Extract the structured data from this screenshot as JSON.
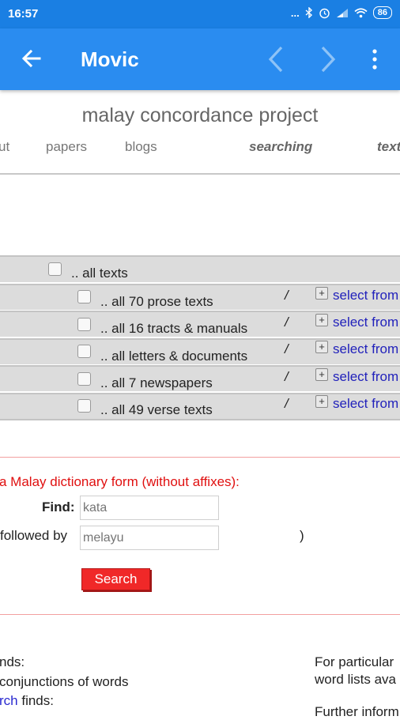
{
  "status_bar": {
    "time": "16:57",
    "indicators": "...",
    "battery": "86"
  },
  "app_bar": {
    "title": "Movic"
  },
  "page": {
    "site_title": "malay concordance project",
    "nav": [
      "ut",
      "papers",
      "blogs",
      "searching",
      "text"
    ]
  },
  "texts_table": {
    "all_label": ".. all texts",
    "slash": "/",
    "select_label": "select from",
    "rows": [
      {
        "label": ".. all 70 prose texts"
      },
      {
        "label": ".. all 16 tracts & manuals"
      },
      {
        "label": ".. all letters & documents"
      },
      {
        "label": ".. all 7 newspapers"
      },
      {
        "label": ".. all 49 verse texts"
      }
    ]
  },
  "search_form": {
    "instruction": "a Malay dictionary form (without affixes):",
    "find_label": "Find:",
    "find_placeholder": "kata",
    "followed_label": "followed by",
    "followed_placeholder": "melayu",
    "paren": ")",
    "search_button": "Search"
  },
  "footer": {
    "line1": "nds:",
    "line2": "conjunctions of words",
    "line3_link": "rch",
    "line3_text": " finds:",
    "right1": "For particular",
    "right2": "word lists ava",
    "right3": "Further inform"
  },
  "colors": {
    "appbar": "#2a8cf0",
    "statusbar": "#1a7fe3",
    "search_button": "#f02828",
    "link": "#2222bb"
  }
}
